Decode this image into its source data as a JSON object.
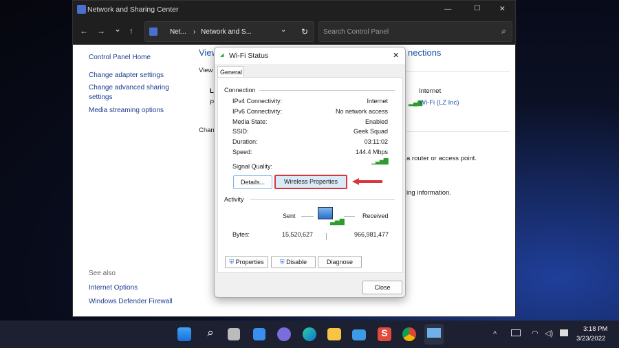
{
  "window": {
    "title": "Network and Sharing Center",
    "minimize": "—",
    "maximize": "☐",
    "close": "✕"
  },
  "nav": {
    "back": "←",
    "forward": "→",
    "recent": "⌄",
    "up": "↑",
    "breadcrumb": [
      "Net...",
      "Network and S..."
    ],
    "sep": "›",
    "dropdown": "⌄",
    "refresh": "↻",
    "search_placeholder": "Search Control Panel",
    "search_icon": "⌕"
  },
  "sidebar": {
    "items": [
      "Control Panel Home",
      "Change adapter settings",
      "Change advanced sharing settings",
      "Media streaming options"
    ],
    "see_also_label": "See also",
    "see_also": [
      "Internet Options",
      "Windows Defender Firewall"
    ]
  },
  "main": {
    "heading_partial": "View",
    "heading_right": "nections",
    "view_partial": "View",
    "L": "L",
    "P": "P",
    "chan": "Chan",
    "access_type": "Internet",
    "connection_link": "Wi-Fi (LZ Inc)",
    "router_text": "a router or access point.",
    "info_text": "ing information."
  },
  "dialog": {
    "title": "Wi-Fi Status",
    "close": "✕",
    "tab": "General",
    "connection_label": "Connection",
    "rows": [
      {
        "label": "IPv4 Connectivity:",
        "value": "Internet"
      },
      {
        "label": "IPv6 Connectivity:",
        "value": "No network access"
      },
      {
        "label": "Media State:",
        "value": "Enabled"
      },
      {
        "label": "SSID:",
        "value": "Geek Squad"
      },
      {
        "label": "Duration:",
        "value": "03:11:02"
      },
      {
        "label": "Speed:",
        "value": "144.4 Mbps"
      }
    ],
    "signal_label": "Signal Quality:",
    "signal_level": 5,
    "details_btn": "Details...",
    "wireless_btn": "Wireless Properties",
    "activity_label": "Activity",
    "sent_label": "Sent",
    "received_label": "Received",
    "bytes_label": "Bytes:",
    "bytes_sent": "15,520,627",
    "bytes_received": "966,981,477",
    "properties_btn": "Properties",
    "disable_btn": "Disable",
    "diagnose_btn": "Diagnose",
    "close_btn": "Close"
  },
  "taskbar": {
    "time": "3:18 PM",
    "date": "3/23/2022",
    "chevron": "^"
  },
  "colors": {
    "annotation": "#d9363e",
    "link": "#1a55a5",
    "signal": "#2e9b2e"
  }
}
